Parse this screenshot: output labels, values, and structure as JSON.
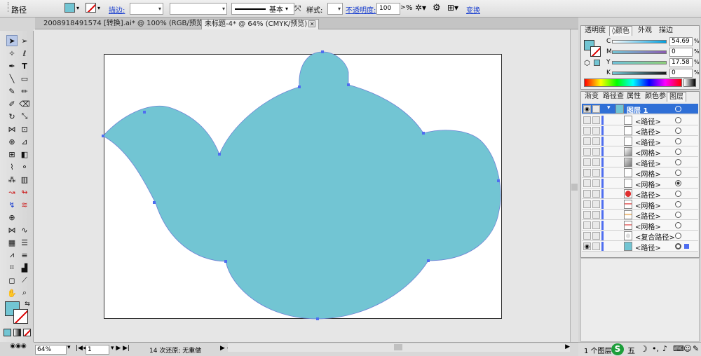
{
  "control_bar": {
    "tool_name": "路径",
    "stroke_label": "描边:",
    "stroke_style": "基本",
    "style_label": "样式:",
    "opacity_label": "不透明度:",
    "opacity_value": "100",
    "opacity_unit": "%",
    "transform_label": "变换"
  },
  "doc_tabs": [
    {
      "label": "2008918491574 [转换].ai* @ 100% (RGB/预览)"
    },
    {
      "label": "未标题-4* @ 64% (CMYK/预览)"
    }
  ],
  "canvas": {
    "fill_color": "#72c5d3"
  },
  "color_panel": {
    "tabs": [
      "透明度",
      "颜色",
      "外观",
      "描边"
    ],
    "active_tab": "颜色",
    "channels": [
      {
        "name": "C",
        "value": "54.69"
      },
      {
        "name": "M",
        "value": "0"
      },
      {
        "name": "Y",
        "value": "17.58"
      },
      {
        "name": "K",
        "value": "0"
      }
    ],
    "percent": "%"
  },
  "layers_panel": {
    "tabs": [
      "渐变",
      "路径查",
      "属性",
      "颜色参",
      "图层"
    ],
    "active_tab": "图层",
    "layer_name": "图层 1",
    "items": [
      "<路径>",
      "<路径>",
      "<路径>",
      "<网格>",
      "<路径>",
      "<网格>",
      "<网格>",
      "<路径>",
      "<网格>",
      "<路径>",
      "<网格>",
      "<复合路径>",
      "<路径>"
    ],
    "footer": "1 个图层"
  },
  "status_bar": {
    "zoom": "64%",
    "page": "1",
    "history": "14 次还原; 无重做"
  },
  "tray": {
    "ime": "五"
  }
}
